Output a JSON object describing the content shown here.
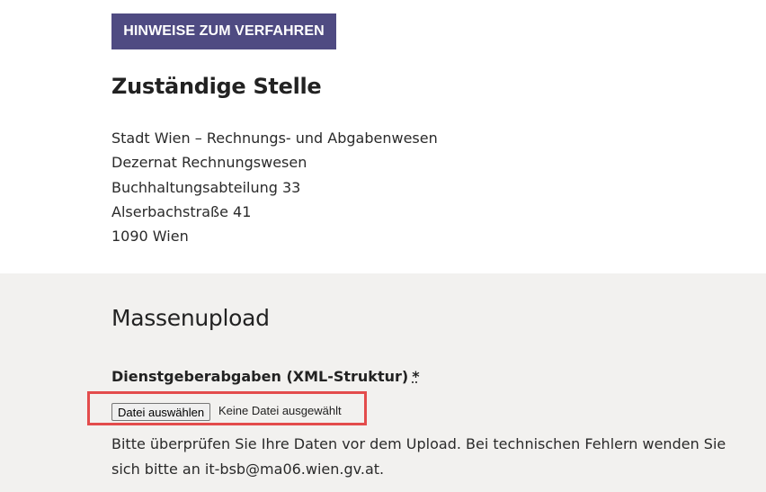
{
  "header_button": {
    "label": "HINWEISE ZUM VERFAHREN"
  },
  "authority": {
    "title": "Zuständige Stelle",
    "address_lines": [
      "Stadt Wien – Rechnungs- und Abgabenwesen",
      "Dezernat Rechnungswesen",
      "Buchhaltungsabteilung 33",
      "Alserbachstraße 41",
      "1090 Wien"
    ]
  },
  "upload": {
    "title": "Massenupload",
    "field_label": "Dienstgeberabgaben (XML-Struktur)",
    "required_marker": "*",
    "file_button_label": "Datei auswählen",
    "file_status": "Keine Datei ausgewählt",
    "help_text": "Bitte überprüfen Sie Ihre Daten vor dem Upload. Bei technischen Fehlern wenden Sie sich bitte an it-bsb@ma06.wien.gv.at."
  },
  "colors": {
    "button_bg": "#4f4b82",
    "section_bg": "#f2f1ef",
    "highlight_border": "#e34c4c"
  }
}
